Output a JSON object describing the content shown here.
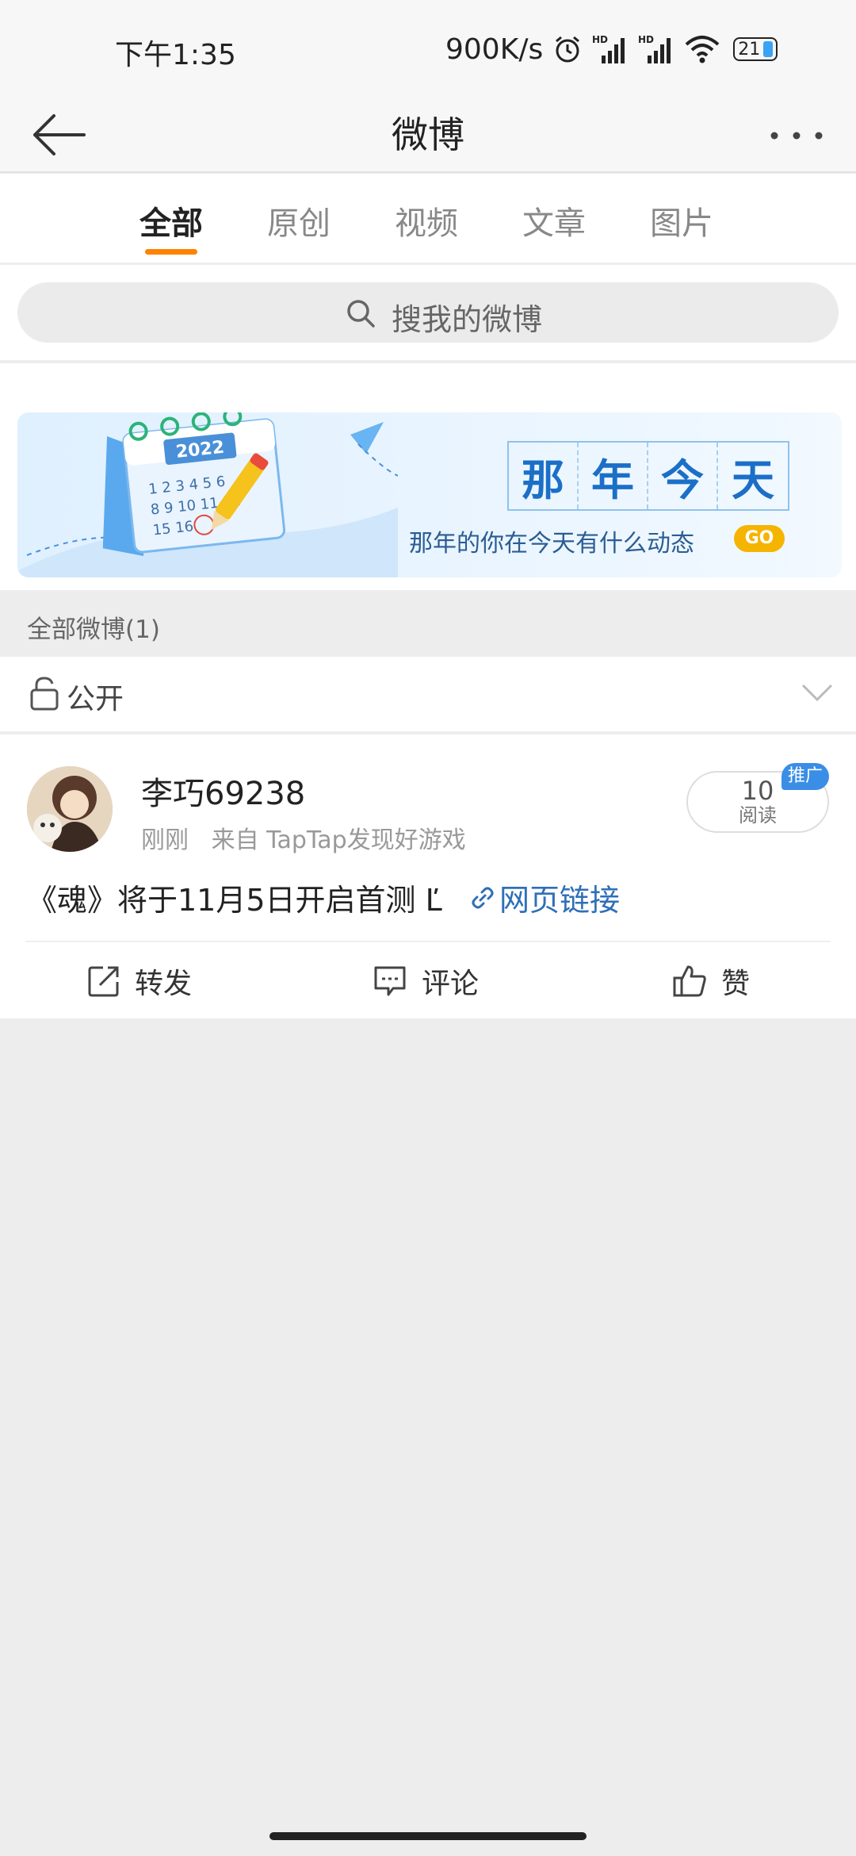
{
  "status_bar": {
    "time": "下午1:35",
    "network_speed": "900K/s",
    "battery_level": "21",
    "icons": [
      "alarm-icon",
      "hd-signal-icon",
      "hd-signal-icon",
      "wifi-icon",
      "battery-icon"
    ]
  },
  "nav": {
    "title": "微博",
    "back_icon": "back-arrow-icon",
    "more_icon": "more-dots-icon"
  },
  "tabs": [
    {
      "label": "全部",
      "active": true
    },
    {
      "label": "原创",
      "active": false
    },
    {
      "label": "视频",
      "active": false
    },
    {
      "label": "文章",
      "active": false
    },
    {
      "label": "图片",
      "active": false
    }
  ],
  "search": {
    "placeholder": "搜我的微博"
  },
  "banner": {
    "calendar_year": "2022",
    "title_chars": [
      "那",
      "年",
      "今",
      "天"
    ],
    "subtitle": "那年的你在今天有什么动态",
    "go_label": "GO"
  },
  "section": {
    "header": "全部微博(1)"
  },
  "filter": {
    "label": "公开"
  },
  "post": {
    "username": "李巧69238",
    "time": "刚刚",
    "source": "来自 TapTap发现好游戏",
    "read_count": "10",
    "read_label": "阅读",
    "promo_badge": "推广",
    "content": "《魂》将于11月5日开启首测 Ľ",
    "link_label": "网页链接",
    "actions": {
      "repost": "转发",
      "comment": "评论",
      "like": "赞"
    }
  },
  "colors": {
    "accent": "#ff8200",
    "link": "#2f6fb7",
    "promo": "#3a8ee6",
    "background": "#ededed"
  }
}
